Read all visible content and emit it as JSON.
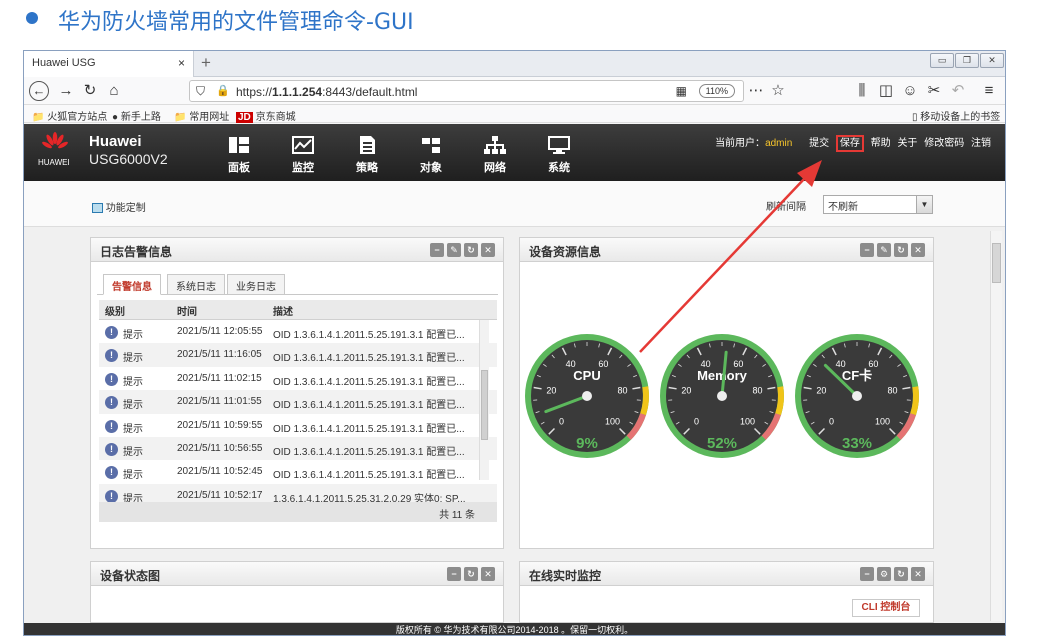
{
  "slide": {
    "title": "华为防火墙常用的文件管理命令-GUI"
  },
  "browser": {
    "tab_title": "Huawei USG",
    "tab_close": "×",
    "new_tab": "+",
    "url_prefix": "https://",
    "url_host": "1.1.1.254",
    "url_rest": ":8443/default.html",
    "zoom": "110%",
    "bookmarks": [
      "火狐官方站点",
      "新手上路",
      "常用网址",
      "京东商城"
    ],
    "mobile_bookmarks": "移动设备上的书签"
  },
  "app": {
    "logo_text": "HUAWEI",
    "brand_line1": "Huawei",
    "brand_line2": "USG6000V2",
    "nav": [
      "面板",
      "监控",
      "策略",
      "对象",
      "网络",
      "系统"
    ],
    "current_user_label": "当前用户：",
    "current_user": "admin",
    "actions": {
      "submit": "提交",
      "save": "保存",
      "help": "帮助",
      "about": "关于",
      "change_password": "修改密码",
      "logout": "注销"
    },
    "func_custom": "功能定制",
    "refresh_label": "刷新间隔",
    "refresh_value": "不刷新",
    "footer": "版权所有 © 华为技术有限公司2014-2018 。保留一切权利。",
    "cli": "CLI 控制台"
  },
  "log_panel": {
    "title": "日志告警信息",
    "tabs": [
      "告警信息",
      "系统日志",
      "业务日志"
    ],
    "columns": [
      "级别",
      "时间",
      "描述"
    ],
    "rows": [
      {
        "level": "提示",
        "time": "2021/5/11 12:05:55",
        "desc": "OID 1.3.6.1.4.1.2011.5.25.191.3.1 配置已..."
      },
      {
        "level": "提示",
        "time": "2021/5/11 11:16:05",
        "desc": "OID 1.3.6.1.4.1.2011.5.25.191.3.1 配置已..."
      },
      {
        "level": "提示",
        "time": "2021/5/11 11:02:15",
        "desc": "OID 1.3.6.1.4.1.2011.5.25.191.3.1 配置已..."
      },
      {
        "level": "提示",
        "time": "2021/5/11 11:01:55",
        "desc": "OID 1.3.6.1.4.1.2011.5.25.191.3.1 配置已..."
      },
      {
        "level": "提示",
        "time": "2021/5/11 10:59:55",
        "desc": "OID 1.3.6.1.4.1.2011.5.25.191.3.1 配置已..."
      },
      {
        "level": "提示",
        "time": "2021/5/11 10:56:55",
        "desc": "OID 1.3.6.1.4.1.2011.5.25.191.3.1 配置已..."
      },
      {
        "level": "提示",
        "time": "2021/5/11 10:52:45",
        "desc": "OID 1.3.6.1.4.1.2011.5.25.191.3.1 配置已..."
      },
      {
        "level": "提示",
        "time": "2021/5/11 10:52:17",
        "desc": "1.3.6.1.4.1.2011.5.25.31.2.0.29 实体0: SP..."
      }
    ],
    "total": "共 11 条"
  },
  "resource_panel": {
    "title": "设备资源信息",
    "gauges": [
      {
        "label": "CPU",
        "value": 9,
        "display": "9%"
      },
      {
        "label": "Memory",
        "value": 52,
        "display": "52%"
      },
      {
        "label": "CF卡",
        "value": 33,
        "display": "33%"
      }
    ],
    "ticks": [
      "0",
      "20",
      "40",
      "60",
      "80",
      "100"
    ]
  },
  "status_panel": {
    "title": "设备状态图"
  },
  "monitor_panel": {
    "title": "在线实时监控"
  },
  "colors": {
    "accent": "#2e74c8",
    "highlight_box": "#e53935",
    "gauge_green": "#5cb85c",
    "gauge_yellow": "#f0c419",
    "gauge_red": "#e57373"
  }
}
